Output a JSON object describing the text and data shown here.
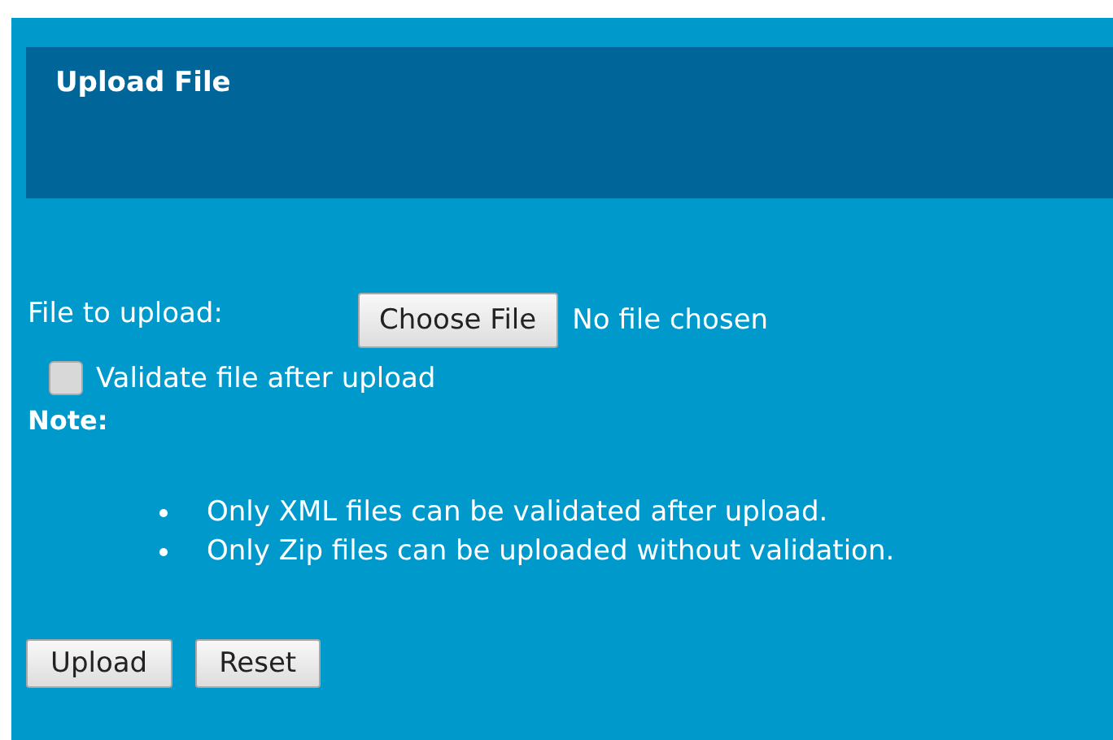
{
  "header": {
    "title": "Upload File"
  },
  "file_input": {
    "label": "File to upload:",
    "button": "Choose File",
    "status": "No file chosen"
  },
  "validate": {
    "label": "Validate file after upload",
    "checked": false
  },
  "note": {
    "heading": "Note:",
    "items": [
      "Only XML files can be validated after upload.",
      "Only Zip files can be uploaded without validation."
    ]
  },
  "buttons": [
    "Upload",
    "Reset"
  ]
}
